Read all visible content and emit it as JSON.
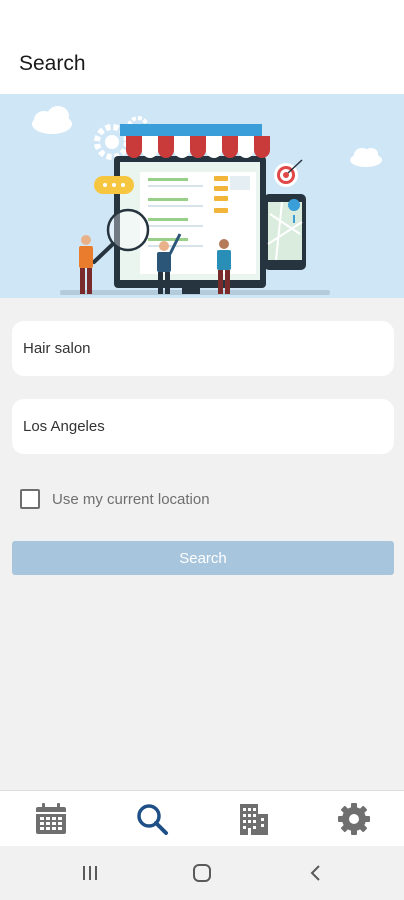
{
  "header": {
    "title": "Search"
  },
  "search": {
    "keyword": {
      "value": "Hair salon",
      "placeholder": ""
    },
    "location": {
      "value": "Los Angeles",
      "placeholder": ""
    },
    "use_location_label": "Use my current location",
    "submit_label": "Search"
  },
  "bottom_nav": {
    "items": [
      {
        "icon": "calendar-icon",
        "active": false
      },
      {
        "icon": "search-icon",
        "active": true
      },
      {
        "icon": "building-icon",
        "active": false
      },
      {
        "icon": "gear-icon",
        "active": false
      }
    ]
  },
  "system_nav": {
    "items": [
      "recent-apps-icon",
      "home-icon",
      "back-icon"
    ]
  },
  "colors": {
    "accent": "#1e4f86",
    "icon_inactive": "#6f6f6f",
    "button_disabled": "#a7c5dc",
    "hero_sky": "#cfe6f6"
  }
}
